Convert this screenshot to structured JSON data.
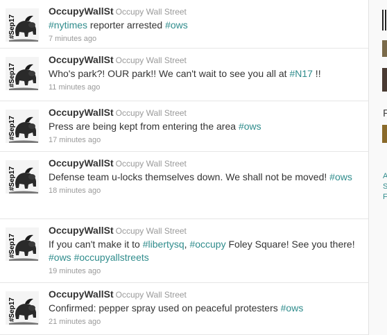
{
  "tweets": [
    {
      "screen_name": "OccupyWallSt",
      "full_name": "Occupy Wall Street",
      "segments": [
        {
          "t": "#nytimes",
          "h": true
        },
        {
          "t": " reporter arrested ",
          "h": false
        },
        {
          "t": "#ows",
          "h": true
        }
      ],
      "time": "7 minutes ago"
    },
    {
      "screen_name": "OccupyWallSt",
      "full_name": "Occupy Wall Street",
      "segments": [
        {
          "t": "Who's park?! OUR park!! We can't wait to see you all at ",
          "h": false
        },
        {
          "t": "#N17",
          "h": true
        },
        {
          "t": " !!",
          "h": false
        }
      ],
      "time": "11 minutes ago"
    },
    {
      "screen_name": "OccupyWallSt",
      "full_name": "Occupy Wall Street",
      "segments": [
        {
          "t": "Press are being kept from entering the area ",
          "h": false
        },
        {
          "t": "#ows",
          "h": true
        }
      ],
      "time": "17 minutes ago"
    },
    {
      "screen_name": "OccupyWallSt",
      "full_name": "Occupy Wall Street",
      "segments": [
        {
          "t": "Defense team u-locks themselves down. We shall not be moved! ",
          "h": false
        },
        {
          "t": "#ows",
          "h": true
        }
      ],
      "time": "18 minutes ago"
    },
    {
      "screen_name": "OccupyWallSt",
      "full_name": "Occupy Wall Street",
      "segments": [
        {
          "t": "If you can't make it to ",
          "h": false
        },
        {
          "t": "#libertysq",
          "h": true
        },
        {
          "t": ", ",
          "h": false
        },
        {
          "t": "#occupy",
          "h": true
        },
        {
          "t": " Foley Square! See you there! ",
          "h": false
        },
        {
          "t": "#ows",
          "h": true
        },
        {
          "t": " ",
          "h": false
        },
        {
          "t": "#occupyallstreets",
          "h": true
        }
      ],
      "time": "19 minutes ago"
    },
    {
      "screen_name": "OccupyWallSt",
      "full_name": "Occupy Wall Street",
      "segments": [
        {
          "t": "Confirmed: pepper spray used on peaceful protesters ",
          "h": false
        },
        {
          "t": "#ows",
          "h": true
        }
      ],
      "time": "21 minutes ago"
    }
  ],
  "avatar_text": "#Sep17",
  "sidebar": {
    "heading_letter": "F",
    "letters": [
      "A",
      "S",
      "F"
    ]
  },
  "colors": {
    "hashtag": "#2f8c8c",
    "screen_name": "#333333",
    "meta": "#999999"
  }
}
